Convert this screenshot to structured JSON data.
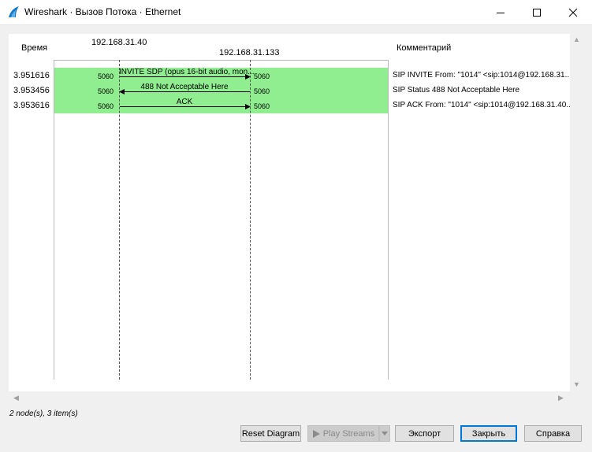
{
  "window": {
    "title": "Wireshark · Вызов Потока · Ethernet"
  },
  "diagram": {
    "header_time": "Время",
    "header_comment": "Комментарий",
    "node_a": "192.168.31.40",
    "node_b": "192.168.31.133",
    "row_color": "#90ee90",
    "rows": [
      {
        "time": "3.951616",
        "src_port": "5060",
        "dst_port": "5060",
        "label": "INVITE SDP (opus 16-bit audio, mon...",
        "direction": "right",
        "comment": "SIP INVITE From: \"1014\" <sip:1014@192.168.31..."
      },
      {
        "time": "3.953456",
        "src_port": "5060",
        "dst_port": "5060",
        "label": "488 Not Acceptable Here",
        "direction": "left",
        "comment": "SIP Status 488 Not Acceptable Here"
      },
      {
        "time": "3.953616",
        "src_port": "5060",
        "dst_port": "5060",
        "label": "ACK",
        "direction": "right",
        "comment": "SIP ACK From: \"1014\" <sip:1014@192.168.31.40..."
      }
    ]
  },
  "status": "2 node(s), 3 item(s)",
  "buttons": {
    "reset": "Reset Diagram",
    "play": "Play Streams",
    "export": "Экспорт",
    "close": "Закрыть",
    "help": "Справка"
  }
}
